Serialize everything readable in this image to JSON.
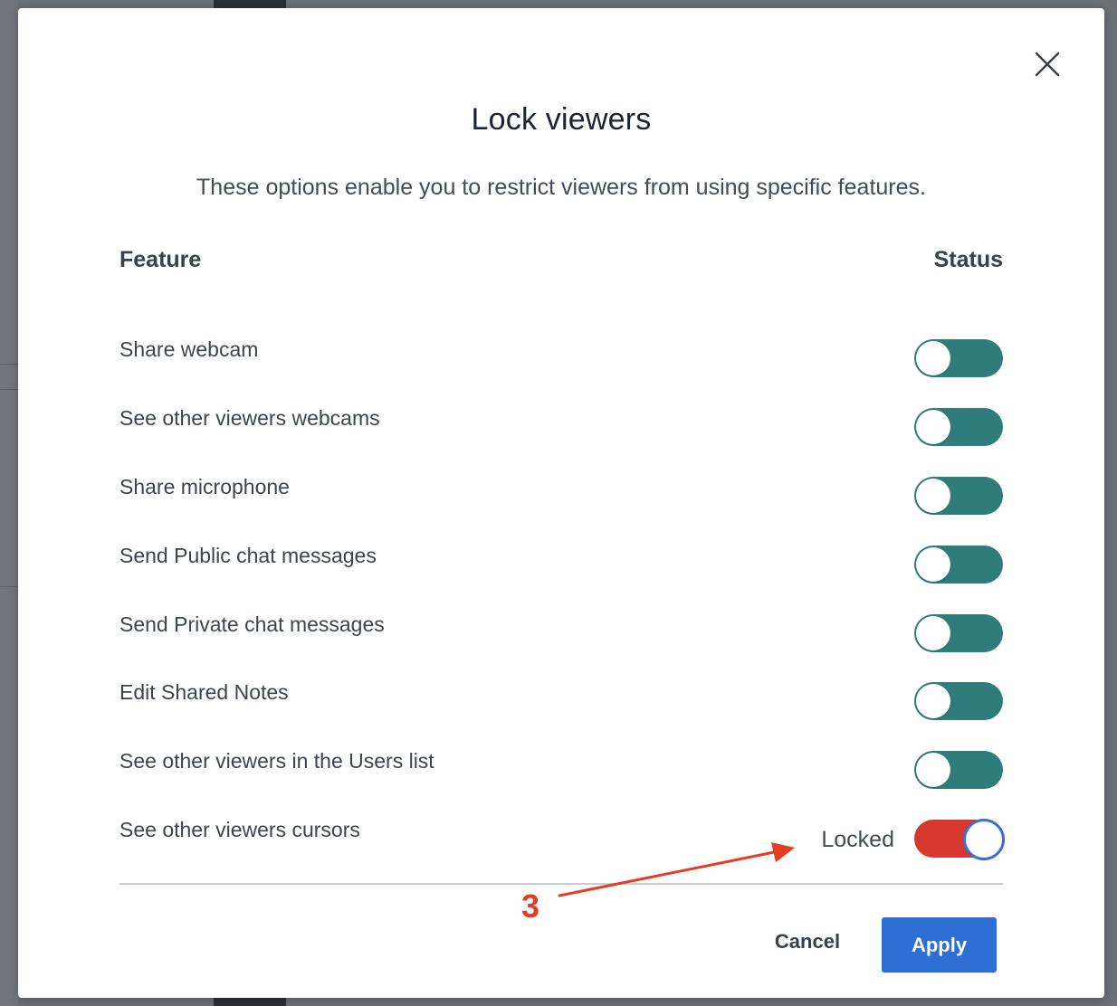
{
  "modal": {
    "title": "Lock viewers",
    "description": "These options enable you to restrict viewers from using specific features.",
    "columns": {
      "feature": "Feature",
      "status": "Status"
    },
    "features": [
      {
        "label": "Share webcam",
        "locked": false
      },
      {
        "label": "See other viewers webcams",
        "locked": false
      },
      {
        "label": "Share microphone",
        "locked": false
      },
      {
        "label": "Send Public chat messages",
        "locked": false
      },
      {
        "label": "Send Private chat messages",
        "locked": false
      },
      {
        "label": "Edit Shared Notes",
        "locked": false
      },
      {
        "label": "See other viewers in the Users list",
        "locked": false
      },
      {
        "label": "See other viewers cursors",
        "locked": true,
        "status_text": "Locked"
      }
    ],
    "buttons": {
      "cancel": "Cancel",
      "apply": "Apply"
    },
    "close_icon": "close-icon"
  },
  "annotation": {
    "number": "3",
    "color": "#e43d24"
  },
  "colors": {
    "toggle_unlocked": "#2f7d7a",
    "toggle_locked": "#d6382f",
    "apply_button": "#2e6fd6"
  }
}
